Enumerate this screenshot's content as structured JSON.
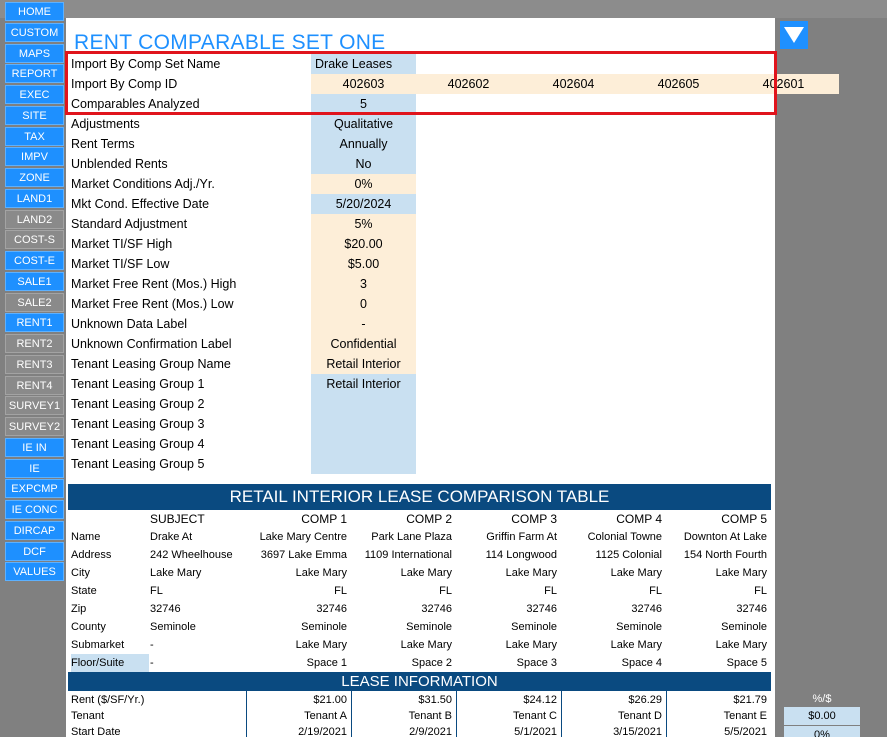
{
  "nav": {
    "items": [
      {
        "label": "HOME",
        "active": true
      },
      {
        "label": "CUSTOM",
        "active": true
      },
      {
        "label": "MAPS",
        "active": true
      },
      {
        "label": "REPORT",
        "active": true
      },
      {
        "label": "EXEC",
        "active": true
      },
      {
        "label": "SITE",
        "active": true
      },
      {
        "label": "TAX",
        "active": true
      },
      {
        "label": "IMPV",
        "active": true
      },
      {
        "label": "ZONE",
        "active": true
      },
      {
        "label": "LAND1",
        "active": true
      },
      {
        "label": "LAND2",
        "active": false
      },
      {
        "label": "COST-S",
        "active": false
      },
      {
        "label": "COST-E",
        "active": true
      },
      {
        "label": "SALE1",
        "active": true
      },
      {
        "label": "SALE2",
        "active": false
      },
      {
        "label": "RENT1",
        "active": true
      },
      {
        "label": "RENT2",
        "active": false
      },
      {
        "label": "RENT3",
        "active": false
      },
      {
        "label": "RENT4",
        "active": false
      },
      {
        "label": "SURVEY1",
        "active": false
      },
      {
        "label": "SURVEY2",
        "active": false
      },
      {
        "label": "IE IN",
        "active": true
      },
      {
        "label": "IE",
        "active": true
      },
      {
        "label": "EXPCMP",
        "active": true
      },
      {
        "label": "IE CONC",
        "active": true
      },
      {
        "label": "DIRCAP",
        "active": true
      },
      {
        "label": "DCF",
        "active": true
      },
      {
        "label": "VALUES",
        "active": true
      }
    ]
  },
  "page": {
    "title": "RENT COMPARABLE SET ONE"
  },
  "params": {
    "comp_set_name_label": "Import By Comp Set Name",
    "comp_set_name_value": "Drake Leases",
    "comp_id_label": "Import By Comp ID",
    "comp_ids": [
      "402603",
      "402602",
      "402604",
      "402605",
      "402601"
    ],
    "rows": [
      {
        "label": "Comparables Analyzed",
        "value": "5",
        "bg": "blue"
      },
      {
        "label": "Adjustments",
        "value": "Qualitative",
        "bg": "blue"
      },
      {
        "label": "Rent Terms",
        "value": "Annually",
        "bg": "blue"
      },
      {
        "label": "Unblended Rents",
        "value": "No",
        "bg": "blue"
      },
      {
        "label": "Market Conditions Adj./Yr.",
        "value": "0%",
        "bg": "peach"
      },
      {
        "label": "Mkt Cond. Effective Date",
        "value": "5/20/2024",
        "bg": "blue"
      },
      {
        "label": "Standard Adjustment",
        "value": "5%",
        "bg": "peach"
      },
      {
        "label": "Market TI/SF High",
        "value": "$20.00",
        "bg": "peach"
      },
      {
        "label": "Market TI/SF Low",
        "value": "$5.00",
        "bg": "peach"
      },
      {
        "label": "Market Free Rent (Mos.) High",
        "value": "3",
        "bg": "peach"
      },
      {
        "label": "Market Free Rent (Mos.) Low",
        "value": "0",
        "bg": "peach"
      },
      {
        "label": "Unknown Data Label",
        "value": "-",
        "bg": "peach"
      },
      {
        "label": "Unknown Confirmation Label",
        "value": "Confidential",
        "bg": "peach"
      },
      {
        "label": "Tenant Leasing Group Name",
        "value": "Retail Interior",
        "bg": "peach"
      },
      {
        "label": "Tenant Leasing Group 1",
        "value": "Retail Interior",
        "bg": "blue"
      },
      {
        "label": "Tenant Leasing Group 2",
        "value": "",
        "bg": "blue"
      },
      {
        "label": "Tenant Leasing Group 3",
        "value": "",
        "bg": "blue"
      },
      {
        "label": "Tenant Leasing Group 4",
        "value": "",
        "bg": "blue"
      },
      {
        "label": "Tenant Leasing Group 5",
        "value": "",
        "bg": "blue"
      }
    ]
  },
  "table": {
    "title": "RETAIL INTERIOR LEASE COMPARISON TABLE",
    "columns": [
      "SUBJECT",
      "COMP 1",
      "COMP 2",
      "COMP 3",
      "COMP 4",
      "COMP 5"
    ],
    "rows": [
      {
        "label": "Name",
        "cells": [
          "Drake At",
          "Lake Mary Centre",
          "Park Lane Plaza",
          "Griffin Farm At",
          "Colonial Towne",
          "Downton At Lake"
        ]
      },
      {
        "label": "Address",
        "cells": [
          "242 Wheelhouse",
          "3697 Lake Emma",
          "1109 International",
          "114 Longwood",
          "1125 Colonial",
          "154 North Fourth"
        ]
      },
      {
        "label": "City",
        "cells": [
          "Lake Mary",
          "Lake Mary",
          "Lake Mary",
          "Lake Mary",
          "Lake Mary",
          "Lake Mary"
        ]
      },
      {
        "label": "State",
        "cells": [
          "FL",
          "FL",
          "FL",
          "FL",
          "FL",
          "FL"
        ]
      },
      {
        "label": "Zip",
        "cells": [
          "32746",
          "32746",
          "32746",
          "32746",
          "32746",
          "32746"
        ]
      },
      {
        "label": "County",
        "cells": [
          "Seminole",
          "Seminole",
          "Seminole",
          "Seminole",
          "Seminole",
          "Seminole"
        ]
      },
      {
        "label": "Submarket",
        "cells": [
          "-",
          "Lake Mary",
          "Lake Mary",
          "Lake Mary",
          "Lake Mary",
          "Lake Mary"
        ]
      },
      {
        "label": "Floor/Suite",
        "cells": [
          "-",
          "Space 1",
          "Space 2",
          "Space 3",
          "Space 4",
          "Space 5"
        ]
      }
    ],
    "lease_title": "LEASE INFORMATION",
    "lease_rows": [
      {
        "label": "Rent ($/SF/Yr.)",
        "cells": [
          "$21.00",
          "$31.50",
          "$24.12",
          "$26.29",
          "$21.79"
        ]
      },
      {
        "label": "Tenant",
        "cells": [
          "Tenant A",
          "Tenant B",
          "Tenant C",
          "Tenant D",
          "Tenant E"
        ]
      },
      {
        "label": "Start Date",
        "cells": [
          "2/19/2021",
          "2/9/2021",
          "5/1/2021",
          "3/15/2021",
          "5/5/2021"
        ]
      }
    ]
  },
  "side": {
    "label": "%/$",
    "values": [
      "$0.00",
      "0%"
    ]
  },
  "colors": {
    "nav_active": "#1e90ff",
    "nav_inactive": "#8a8a8a",
    "header_navy": "#0a4a80",
    "input_blue": "#c9e0f1",
    "input_peach": "#fdeed8",
    "highlight_red": "#e0141c",
    "title_blue": "#1e90ff"
  }
}
